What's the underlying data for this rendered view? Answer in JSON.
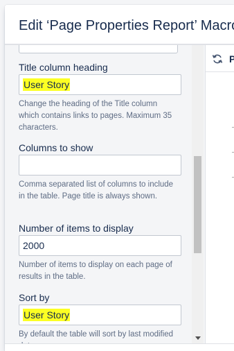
{
  "dialog": {
    "title": "Edit ‘Page Properties Report’ Macro"
  },
  "form": {
    "title_column": {
      "label": "Title column heading",
      "value": "User Story",
      "help": "Change the heading of the Title column which contains links to pages. Maximum 35 characters."
    },
    "columns_to_show": {
      "label": "Columns to show",
      "value": "",
      "help": "Comma separated list of columns to include in the table. Page title is always shown."
    },
    "items_to_display": {
      "label": "Number of items to display",
      "value": "2000",
      "help": "Number of items to display on each page of results in the table."
    },
    "sort_by": {
      "label": "Sort by",
      "value": "User Story",
      "help": "By default the table will sort by last modified date."
    }
  },
  "preview": {
    "toolbar_label": "P",
    "refresh_icon": "refresh-icon"
  },
  "colors": {
    "highlight": "#fcff23",
    "sidebar_bg": "#f4f5f7",
    "text": "#172b4d",
    "help_text": "#5e6c84"
  }
}
